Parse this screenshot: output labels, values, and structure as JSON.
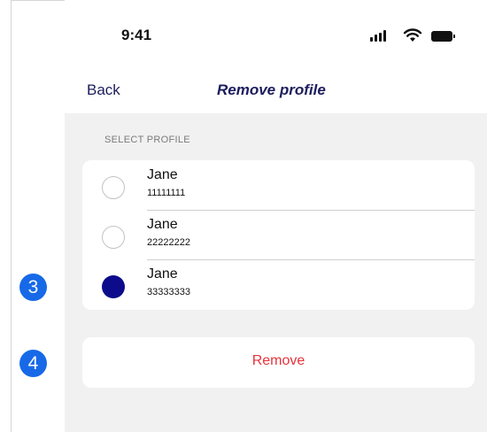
{
  "status_bar": {
    "time": "9:41",
    "icons": [
      "cellular-signal-icon",
      "wifi-icon",
      "battery-icon"
    ]
  },
  "nav": {
    "back_label": "Back",
    "title": "Remove profile"
  },
  "section": {
    "header": "SELECT PROFILE"
  },
  "profiles": [
    {
      "name": "Jane",
      "number": "11111111",
      "selected": false
    },
    {
      "name": "Jane",
      "number": "22222222",
      "selected": false
    },
    {
      "name": "Jane",
      "number": "33333333",
      "selected": true
    }
  ],
  "actions": {
    "remove_label": "Remove"
  },
  "annotations": {
    "step_3": "3",
    "step_4": "4"
  },
  "colors": {
    "accent": "#1d1d5e",
    "selected_radio": "#0b0b8c",
    "destructive": "#e8333b",
    "badge": "#1769e8",
    "background": "#f1f1f1"
  }
}
